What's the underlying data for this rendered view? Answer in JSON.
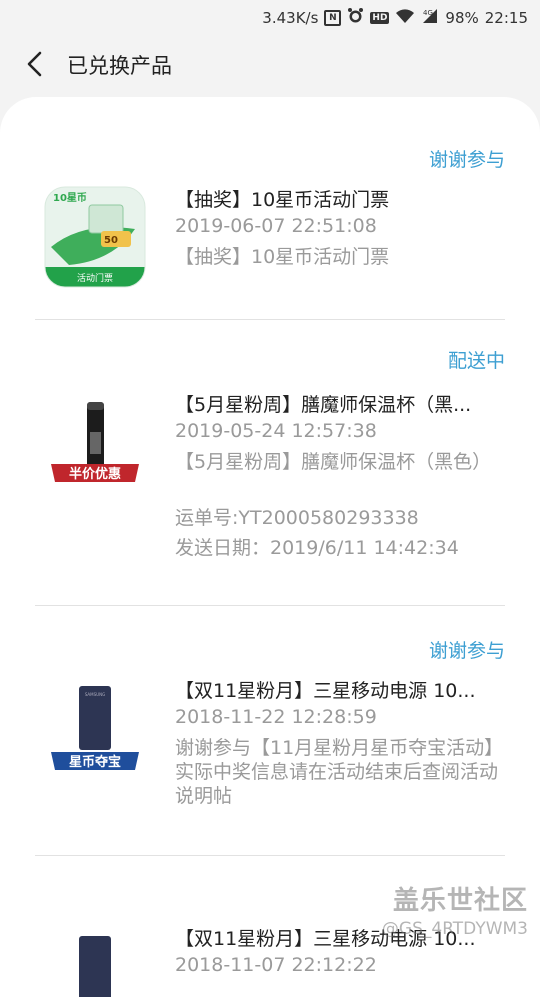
{
  "status_bar": {
    "speed": "3.43K/s",
    "battery": "98%",
    "time": "22:15",
    "icons": [
      "nfc-icon",
      "alarm-icon",
      "hd-icon",
      "wifi-icon",
      "signal-4g-icon"
    ]
  },
  "header": {
    "title": "已兑换产品",
    "back_icon": "chevron-left-icon"
  },
  "items": [
    {
      "status": "谢谢参与",
      "title": "【抽奖】10星币活动门票",
      "time": "2019-06-07 22:51:08",
      "desc": "【抽奖】10星币活动门票",
      "thumb": {
        "brand": "10星币",
        "amount": "50",
        "badge": "活动门票"
      }
    },
    {
      "status": "配送中",
      "title": "【5月星粉周】膳魔师保温杯（黑...",
      "time": "2019-05-24 12:57:38",
      "desc": "【5月星粉周】膳魔师保温杯（黑色）",
      "tracking": "运单号:YT2000580293338",
      "ship_date": "发送日期：2019/6/11 14:42:34",
      "thumb": {
        "badge": "半价优惠"
      }
    },
    {
      "status": "谢谢参与",
      "title": "【双11星粉月】三星移动电源 10...",
      "time": "2018-11-22 12:28:59",
      "desc": "谢谢参与【11月星粉月星币夺宝活动】实际中奖信息请在活动结束后查阅活动说明帖",
      "thumb": {
        "badge": "星币夺宝",
        "label": "SAMSUNG"
      }
    },
    {
      "title": "【双11星粉月】三星移动电源 10...",
      "time": "2018-11-07 22:12:22"
    }
  ],
  "watermark": {
    "line1": "盖乐世社区",
    "line2": "@GS_4RTDYWM3"
  },
  "colors": {
    "accent": "#3d9fd2",
    "badge_red": "#c0262c",
    "badge_blue": "#1f4e9c",
    "green": "#2fa84f"
  }
}
